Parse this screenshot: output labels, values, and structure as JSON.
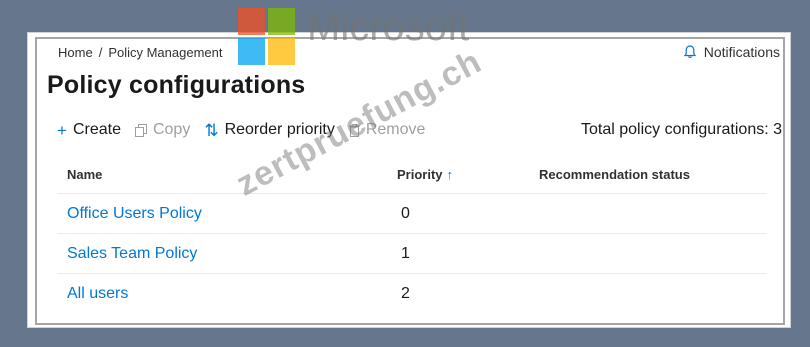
{
  "breadcrumb": {
    "home": "Home",
    "separator": "/",
    "current": "Policy Management"
  },
  "notifications": {
    "label": "Notifications",
    "icon": "bell-icon"
  },
  "page": {
    "title": "Policy configurations"
  },
  "toolbar": {
    "create": {
      "label": "Create",
      "icon": "plus-icon"
    },
    "copy": {
      "label": "Copy",
      "icon": "copy-icon"
    },
    "reorder": {
      "label": "Reorder priority",
      "icon": "reorder-icon"
    },
    "remove": {
      "label": "Remove",
      "icon": "trash-icon"
    },
    "total": "Total policy configurations: 3"
  },
  "table": {
    "headers": {
      "name": "Name",
      "priority": "Priority",
      "status": "Recommendation status"
    },
    "sort_icon": "arrow-up-icon",
    "rows": [
      {
        "name": "Office Users Policy",
        "priority": "0",
        "status": ""
      },
      {
        "name": "Sales Team Policy",
        "priority": "1",
        "status": ""
      },
      {
        "name": "All users",
        "priority": "2",
        "status": ""
      }
    ]
  },
  "overlay": {
    "brand_word": "Microsoft",
    "watermark": "zertpruefung.ch",
    "brand_colors": [
      "#f25022",
      "#7fba00",
      "#00a4ef",
      "#ffb900"
    ]
  },
  "colors": {
    "link": "#0078d4",
    "background": "#66768c"
  }
}
